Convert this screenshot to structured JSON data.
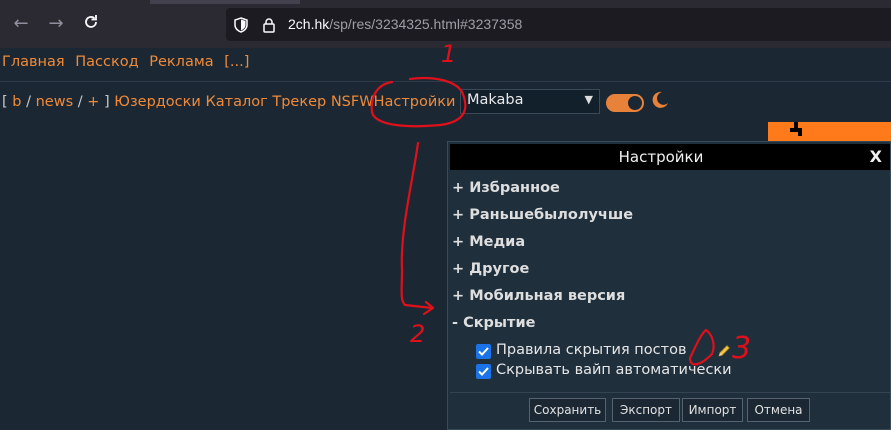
{
  "browser": {
    "url_host": "2ch.hk",
    "url_path": "/sp/res/3234325.html#3237358"
  },
  "topnav": {
    "items": [
      "Главная",
      "Пасскод",
      "Реклама",
      "[...]"
    ]
  },
  "boardnav": {
    "open_bracket": "[",
    "b": "b",
    "slash1": "/",
    "news": "news",
    "slash2": "/",
    "plus": "+",
    "close_bracket": "]",
    "links": [
      "Юзердоски",
      "Каталог",
      "Трекер",
      "NSFW",
      "Настройки"
    ]
  },
  "style_select": {
    "value": "Makaba",
    "arrow": "▼"
  },
  "settings": {
    "title": "Настройки",
    "close": "X",
    "sections": [
      "+ Избранное",
      "+ Раньшебылолучше",
      "+ Медиа",
      "+ Другое",
      "+ Мобильная версия",
      "- Скрытие"
    ],
    "options": [
      {
        "label": "Правила скрытия постов",
        "checked": true
      },
      {
        "label": "Скрывать вайп автоматически",
        "checked": true
      }
    ],
    "buttons": [
      "Сохранить",
      "Экспорт",
      "Импорт",
      "Отмена"
    ]
  },
  "annotations": [
    "1",
    "2",
    "3"
  ],
  "colors": {
    "accent": "#f08a38",
    "background": "#1b2834",
    "annotation": "#e0101a",
    "checkbox": "#1a73e8"
  }
}
